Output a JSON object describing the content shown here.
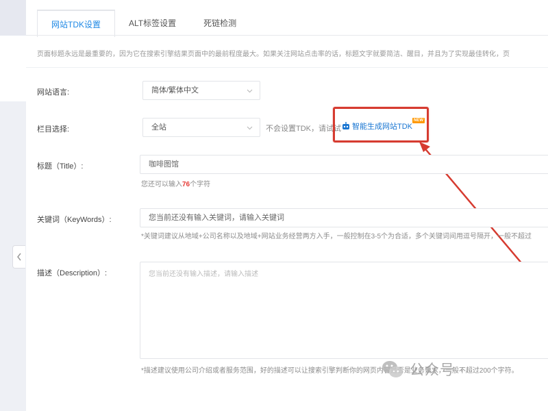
{
  "tabs": [
    {
      "label": "网站TDK设置",
      "active": true
    },
    {
      "label": "ALT标签设置",
      "active": false
    },
    {
      "label": "死链检测",
      "active": false
    }
  ],
  "notice": "页面标题永远是最重要的，因为它在搜索引擎结果页面中的最前程度最大。如果关注网站点击率的话，标题文字就要简洁、醒目，并且为了实现最佳转化，页",
  "form": {
    "language": {
      "label": "网站语言:",
      "value": "简体/繁体中文"
    },
    "column": {
      "label": "栏目选择:",
      "value": "全站",
      "hint": "不会设置TDK，请试试",
      "ai_link": "智能生成网站TDK",
      "badge": "NEW"
    },
    "title": {
      "label": "标题（Title）:",
      "value": "咖啡图馆",
      "hint_prefix": "您还可以输入",
      "hint_count": "76",
      "hint_suffix": "个字符"
    },
    "keywords": {
      "label": "关键词（KeyWords）:",
      "value": "您当前还没有输入关键词，请输入关键词",
      "hint": "*关键词建议从地域+公司名称以及地域+网站业务经营两方入手，一般控制在3-5个为合适，多个关键词间用逗号隔开，一般不超过"
    },
    "description": {
      "label": "描述（Description）:",
      "placeholder": "您当前还没有输入描述，请输入描述",
      "hint": "*描述建议使用公司介绍或者服务范围，好的描述可以让搜索引擎判断你的网页内容是否是业务要求，一般不超过200个字符。"
    }
  },
  "watermark": {
    "text": "公众号 ·",
    "icon": "wechat-icon"
  },
  "colors": {
    "accent": "#1e88e5",
    "highlight": "#d63b30",
    "badge": "#ff9800"
  }
}
